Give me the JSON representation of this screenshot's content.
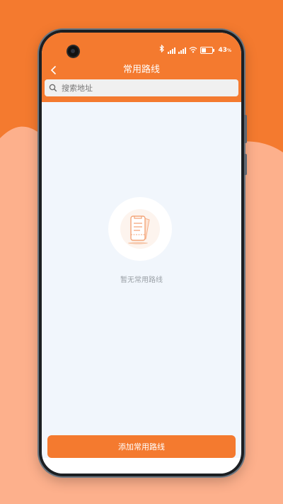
{
  "colors": {
    "brand_orange": "#f47a2f",
    "wave_light": "#fdb08c",
    "screen_bg": "#f1f6fc",
    "empty_text": "#9aa0a6"
  },
  "status_bar": {
    "battery": "43",
    "battery_unit": "%",
    "icons": [
      "bluetooth-icon",
      "signal-icon",
      "signal-icon",
      "wifi-icon",
      "battery-icon"
    ]
  },
  "header": {
    "title": "常用路线",
    "back_icon": "chevron-left-icon"
  },
  "search": {
    "placeholder": "搜索地址",
    "value": "",
    "icon": "search-icon"
  },
  "empty_state": {
    "icon": "ticket-icon",
    "message": "暂无常用路线"
  },
  "footer": {
    "add_button_label": "添加常用路线"
  }
}
